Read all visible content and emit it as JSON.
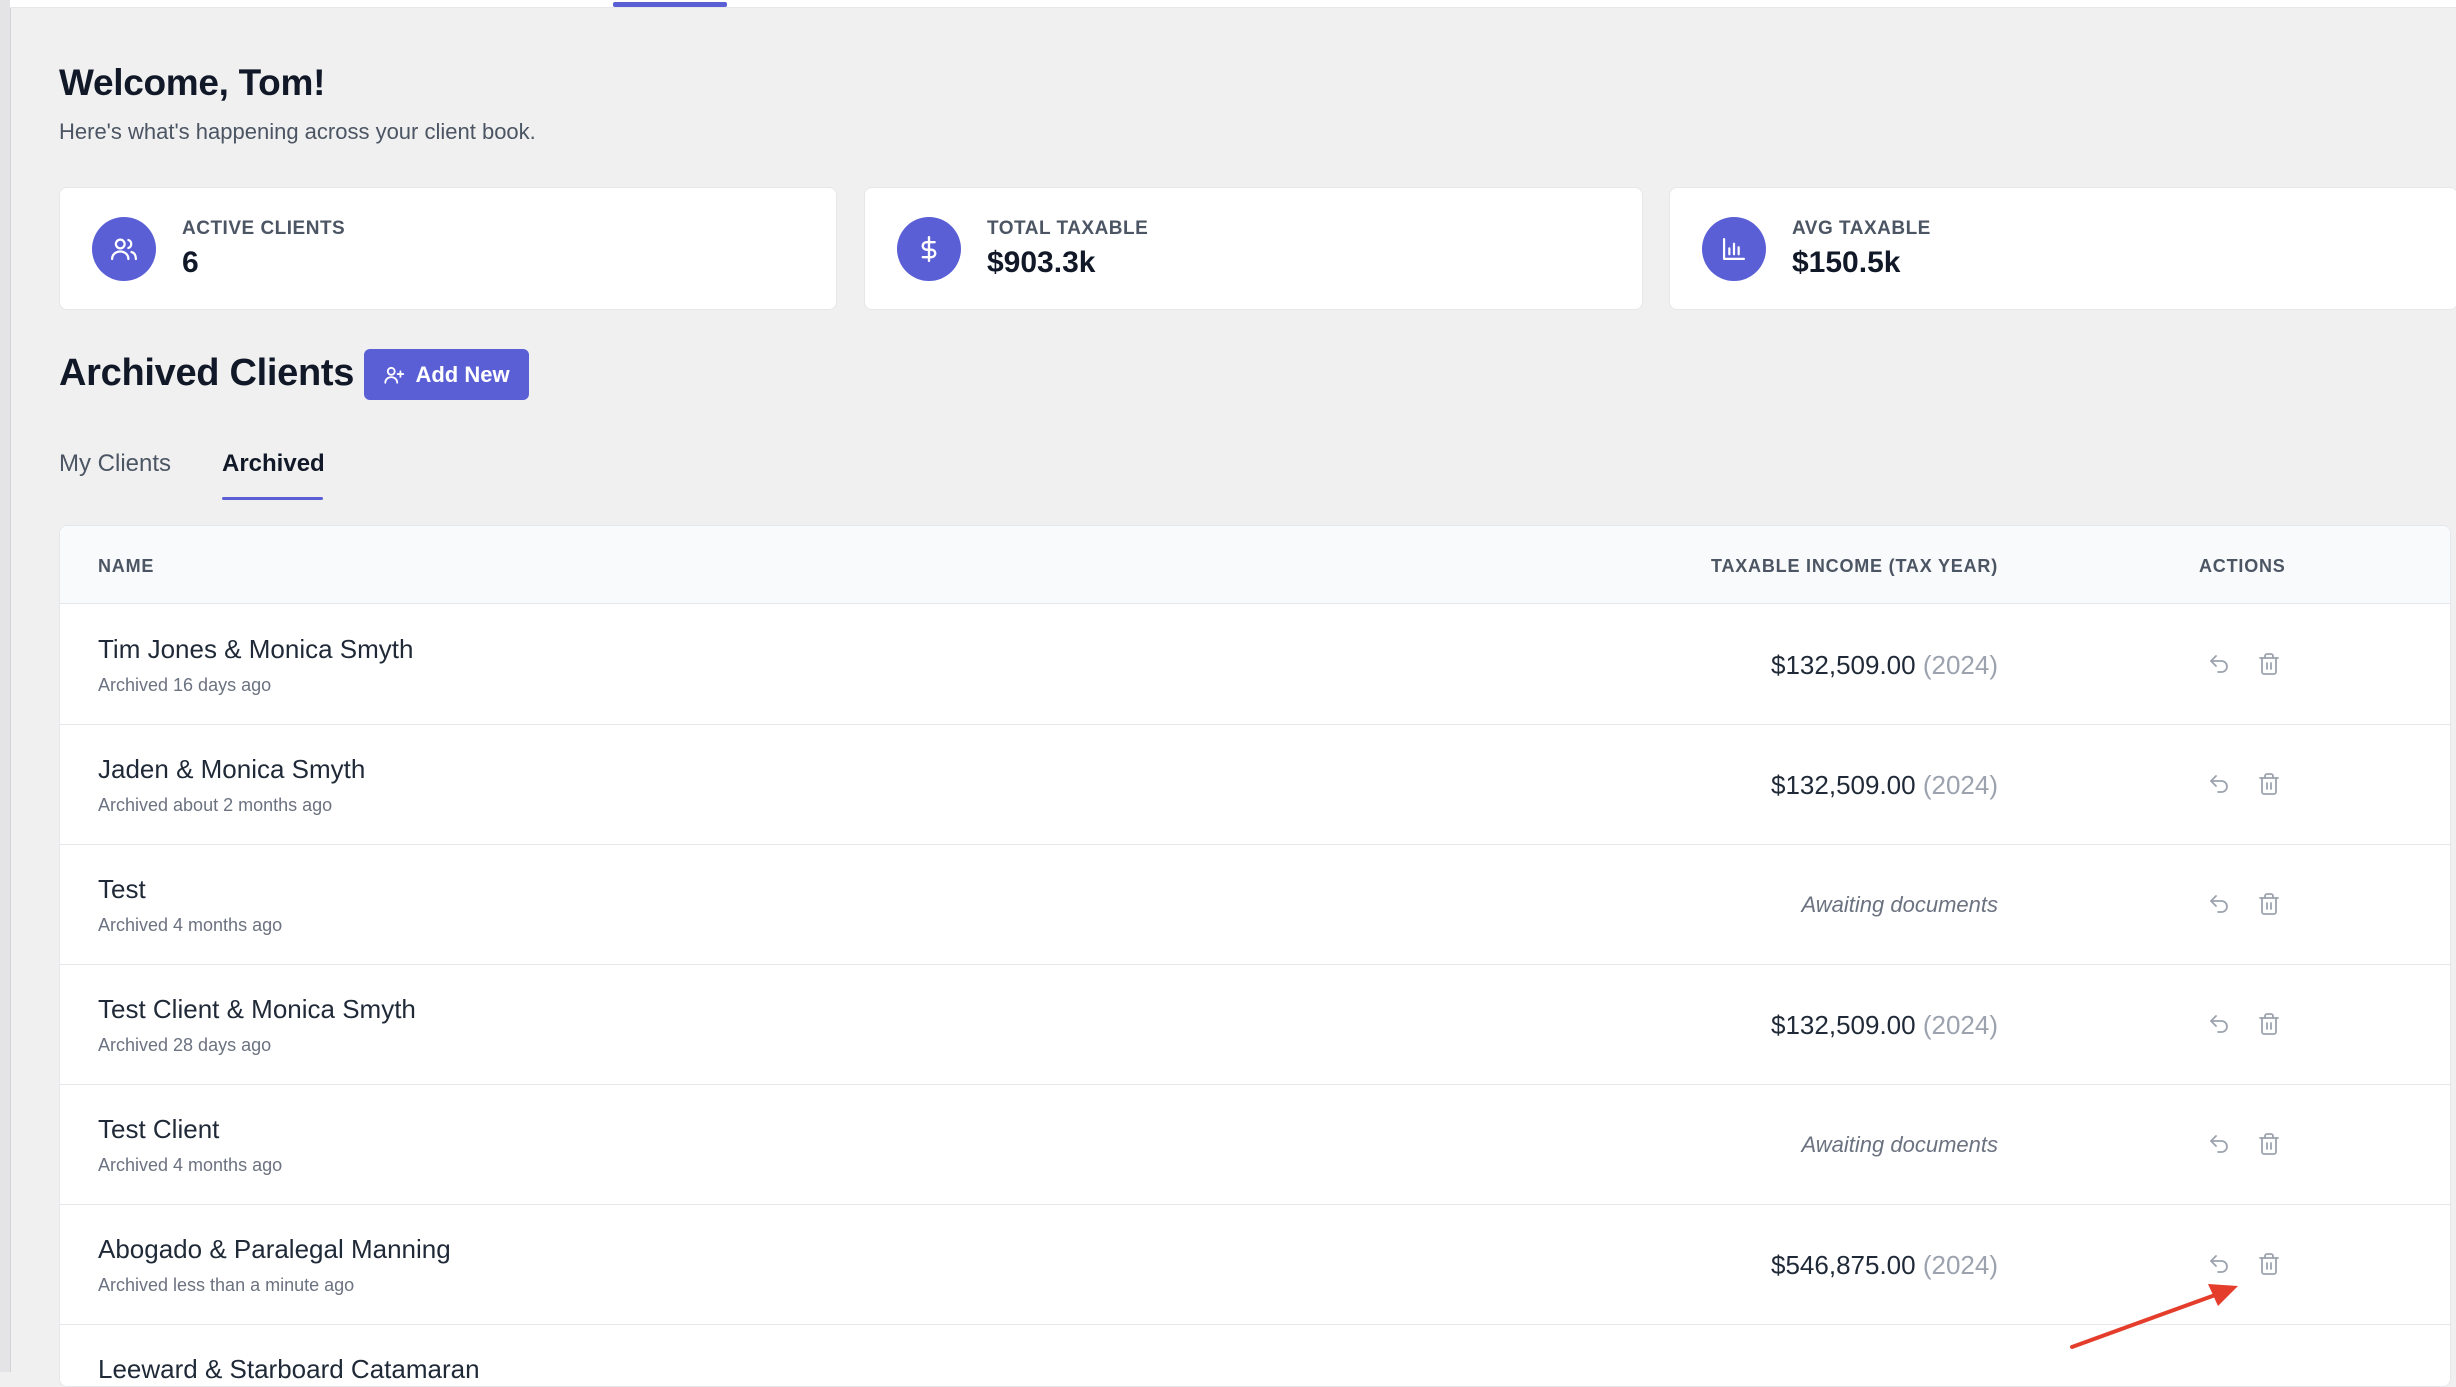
{
  "header": {
    "welcome": "Welcome, Tom!",
    "subtitle": "Here's what's happening across your client book."
  },
  "stats": [
    {
      "label": "ACTIVE CLIENTS",
      "value": "6",
      "icon": "users-icon"
    },
    {
      "label": "TOTAL TAXABLE",
      "value": "$903.3k",
      "icon": "dollar-icon"
    },
    {
      "label": "AVG TAXABLE",
      "value": "$150.5k",
      "icon": "bar-chart-icon"
    }
  ],
  "section": {
    "title": "Archived Clients",
    "add_label": "Add New"
  },
  "tabs": [
    {
      "label": "My Clients",
      "active": false
    },
    {
      "label": "Archived",
      "active": true
    }
  ],
  "table": {
    "headers": {
      "name": "NAME",
      "income": "TAXABLE INCOME (TAX YEAR)",
      "actions": "ACTIONS"
    },
    "rows": [
      {
        "name": "Tim Jones & Monica Smyth",
        "meta": "Archived 16 days ago",
        "amount": "$132,509.00",
        "year": "(2024)"
      },
      {
        "name": "Jaden & Monica Smyth",
        "meta": "Archived about 2 months ago",
        "amount": "$132,509.00",
        "year": "(2024)"
      },
      {
        "name": "Test",
        "meta": "Archived 4 months ago",
        "status": "Awaiting documents"
      },
      {
        "name": "Test Client & Monica Smyth",
        "meta": "Archived 28 days ago",
        "amount": "$132,509.00",
        "year": "(2024)"
      },
      {
        "name": "Test Client",
        "meta": "Archived 4 months ago",
        "status": "Awaiting documents"
      },
      {
        "name": "Abogado & Paralegal Manning",
        "meta": "Archived less than a minute ago",
        "amount": "$546,875.00",
        "year": "(2024)"
      },
      {
        "name": "Leeward & Starboard Catamaran",
        "meta": ""
      }
    ]
  },
  "colors": {
    "accent": "#5b5fd6",
    "annotation_arrow": "#e53d2b"
  }
}
